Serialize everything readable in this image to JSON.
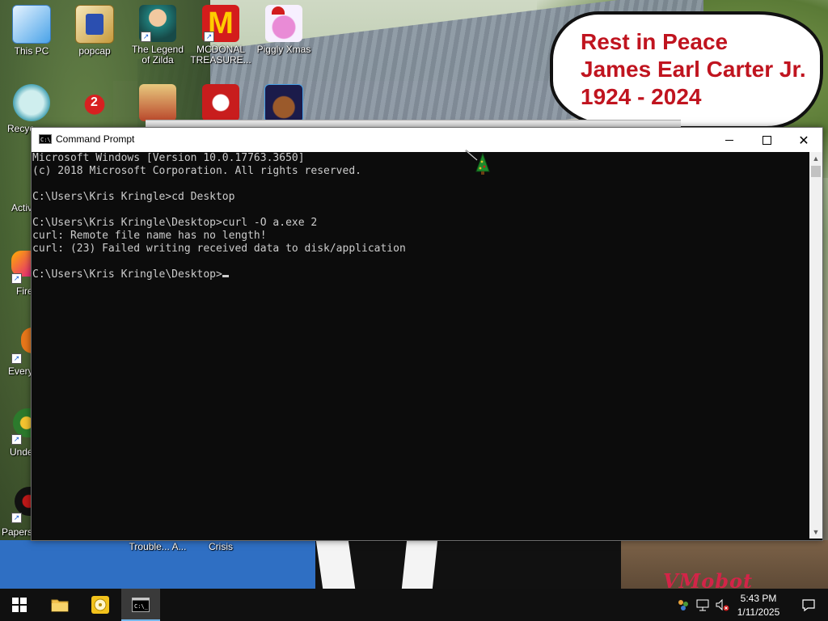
{
  "memorial": {
    "line1": "Rest in Peace",
    "line2": "James Earl Carter Jr.",
    "line3": "1924 - 2024"
  },
  "watermark": "VMobot",
  "desktop_icons": [
    {
      "label": "This PC",
      "icon": "computer-icon"
    },
    {
      "label": "popcap",
      "icon": "folder-icon"
    },
    {
      "label": "The Legend\nof Zilda",
      "icon": "game-icon"
    },
    {
      "label": "MCDONAL\nTREASURE...",
      "icon": "mcdonalds-icon"
    },
    {
      "label": "Piggly Xmas",
      "icon": "pig-icon"
    },
    {
      "label": "Recyc",
      "icon": "recycle-bin-icon"
    },
    {
      "label": "Activ",
      "icon": "app-icon"
    },
    {
      "label": "Fire",
      "icon": "firefox-icon"
    },
    {
      "label": "Every",
      "icon": "app-icon"
    },
    {
      "label": "Unde",
      "icon": "app-icon"
    },
    {
      "label": "Papers",
      "icon": "app-icon"
    },
    {
      "label": "Trouble... A...",
      "icon": "app-icon"
    },
    {
      "label": "Crisis",
      "icon": "app-icon"
    }
  ],
  "window": {
    "title": "Command Prompt",
    "minimize_label": "Minimize",
    "maximize_label": "Maximize",
    "close_label": "Close"
  },
  "console": {
    "lines": [
      "Microsoft Windows [Version 10.0.17763.3650]",
      "(c) 2018 Microsoft Corporation. All rights reserved.",
      "",
      "C:\\Users\\Kris Kringle>cd Desktop",
      "",
      "C:\\Users\\Kris Kringle\\Desktop>curl -O a.exe 2",
      "curl: Remote file name has no length!",
      "curl: (23) Failed writing received data to disk/application",
      "",
      "C:\\Users\\Kris Kringle\\Desktop>"
    ],
    "text_color": "#cccccc",
    "background": "#0c0c0c"
  },
  "taskbar": {
    "start": "start-icon",
    "explorer": "file-explorer-icon",
    "pinned": "disc-app-icon",
    "cmd": "command-prompt-icon",
    "time": "5:43 PM",
    "date": "1/11/2025",
    "accent": "#76b9ed"
  }
}
